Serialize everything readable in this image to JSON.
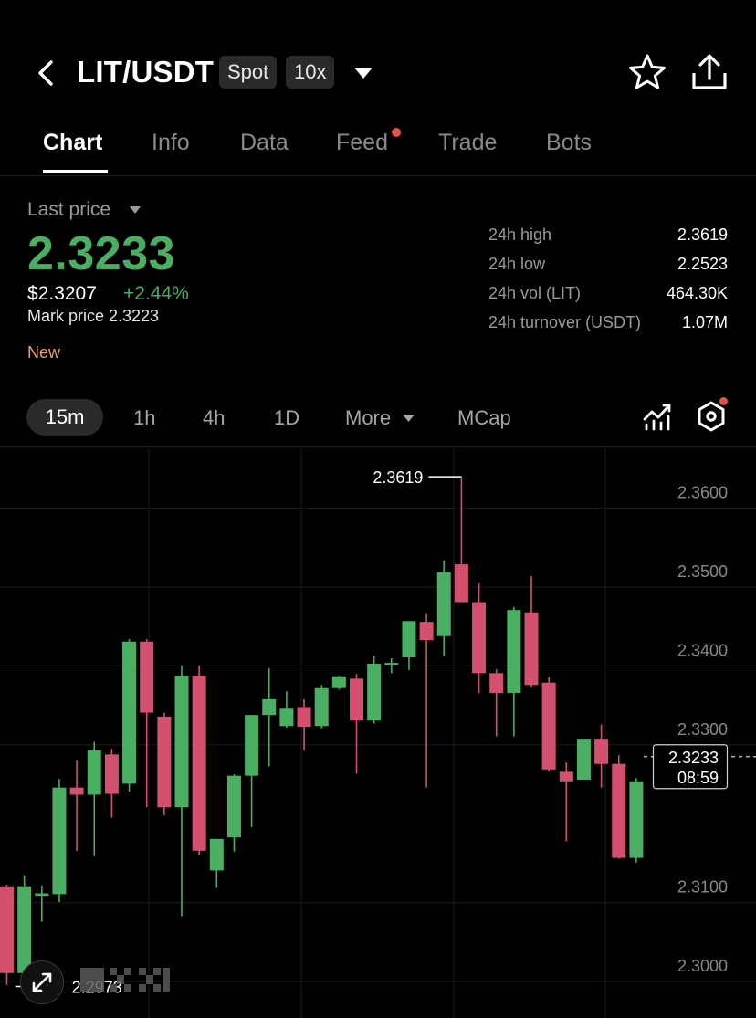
{
  "header": {
    "pair": "LIT/USDT",
    "market_type": "Spot",
    "leverage": "10x",
    "icons": [
      "back-arrow-icon",
      "chevron-down-icon",
      "star-icon",
      "share-icon"
    ]
  },
  "tabs": [
    {
      "label": "Chart",
      "active": true
    },
    {
      "label": "Info",
      "active": false
    },
    {
      "label": "Data",
      "active": false
    },
    {
      "label": "Feed",
      "active": false,
      "notification_dot": true
    },
    {
      "label": "Trade",
      "active": false
    },
    {
      "label": "Bots",
      "active": false
    }
  ],
  "price": {
    "label": "Last price",
    "last": "2.3233",
    "usd": "$2.3207",
    "change": "+2.44%",
    "mark": "Mark price 2.3223",
    "tag": "New"
  },
  "stats": [
    {
      "label": "24h high",
      "value": "2.3619"
    },
    {
      "label": "24h low",
      "value": "2.2523"
    },
    {
      "label": "24h vol (LIT)",
      "value": "464.30K"
    },
    {
      "label": "24h turnover (USDT)",
      "value": "1.07M"
    }
  ],
  "intervals": {
    "selected": "15m",
    "options": [
      "1h",
      "4h",
      "1D"
    ],
    "more": "More",
    "mcap": "MCap"
  },
  "colors": {
    "up": "#4aae63",
    "down": "#d4506f",
    "background": "#000000",
    "accent_dot": "#e2534e"
  },
  "chart_data": {
    "type": "candlestick",
    "interval": "15m",
    "ylim": [
      2.2962,
      2.3633
    ],
    "yticks": [
      "2.3600",
      "2.3500",
      "2.3400",
      "2.3300",
      "2.3100",
      "2.3000"
    ],
    "ytick_values": [
      2.36,
      2.35,
      2.34,
      2.33,
      2.31,
      2.3
    ],
    "high_label": "2.3619",
    "low_label": "2.2973",
    "current_price_label": "2.3233",
    "countdown": "08:59",
    "candles": [
      {
        "o": 2.31,
        "h": 2.3102,
        "l": 2.2975,
        "c": 2.299
      },
      {
        "o": 2.299,
        "h": 2.3114,
        "l": 2.2973,
        "c": 2.31
      },
      {
        "o": 2.3088,
        "h": 2.3101,
        "l": 2.3055,
        "c": 2.3091
      },
      {
        "o": 2.309,
        "h": 2.3236,
        "l": 2.308,
        "c": 2.3225
      },
      {
        "o": 2.3225,
        "h": 2.326,
        "l": 2.3145,
        "c": 2.3216
      },
      {
        "o": 2.3216,
        "h": 2.3283,
        "l": 2.3138,
        "c": 2.3272
      },
      {
        "o": 2.3267,
        "h": 2.3274,
        "l": 2.3187,
        "c": 2.3217
      },
      {
        "o": 2.323,
        "h": 2.3413,
        "l": 2.322,
        "c": 2.341
      },
      {
        "o": 2.341,
        "h": 2.3413,
        "l": 2.32,
        "c": 2.332
      },
      {
        "o": 2.3315,
        "h": 2.332,
        "l": 2.319,
        "c": 2.32
      },
      {
        "o": 2.32,
        "h": 2.338,
        "l": 2.3062,
        "c": 2.3367
      },
      {
        "o": 2.3367,
        "h": 2.338,
        "l": 2.314,
        "c": 2.3145
      },
      {
        "o": 2.312,
        "h": 2.316,
        "l": 2.3098,
        "c": 2.316
      },
      {
        "o": 2.3162,
        "h": 2.3242,
        "l": 2.3144,
        "c": 2.324
      },
      {
        "o": 2.324,
        "h": 2.3317,
        "l": 2.3175,
        "c": 2.3317
      },
      {
        "o": 2.3317,
        "h": 2.3376,
        "l": 2.3252,
        "c": 2.3337
      },
      {
        "o": 2.3303,
        "h": 2.3347,
        "l": 2.3301,
        "c": 2.3325
      },
      {
        "o": 2.3327,
        "h": 2.3337,
        "l": 2.3272,
        "c": 2.3302
      },
      {
        "o": 2.3303,
        "h": 2.3355,
        "l": 2.33,
        "c": 2.3351
      },
      {
        "o": 2.3351,
        "h": 2.3367,
        "l": 2.3349,
        "c": 2.3366
      },
      {
        "o": 2.3363,
        "h": 2.3369,
        "l": 2.3243,
        "c": 2.331
      },
      {
        "o": 2.331,
        "h": 2.3392,
        "l": 2.3306,
        "c": 2.3382
      },
      {
        "o": 2.3382,
        "h": 2.3389,
        "l": 2.337,
        "c": 2.3383
      },
      {
        "o": 2.339,
        "h": 2.3434,
        "l": 2.3374,
        "c": 2.3436
      },
      {
        "o": 2.3435,
        "h": 2.3446,
        "l": 2.3225,
        "c": 2.3412
      },
      {
        "o": 2.3417,
        "h": 2.3513,
        "l": 2.3392,
        "c": 2.3498
      },
      {
        "o": 2.3508,
        "h": 2.3619,
        "l": 2.347,
        "c": 2.346
      },
      {
        "o": 2.346,
        "h": 2.3484,
        "l": 2.3345,
        "c": 2.337
      },
      {
        "o": 2.337,
        "h": 2.3375,
        "l": 2.329,
        "c": 2.3345
      },
      {
        "o": 2.3345,
        "h": 2.3454,
        "l": 2.329,
        "c": 2.345
      },
      {
        "o": 2.3447,
        "h": 2.3493,
        "l": 2.3352,
        "c": 2.3355
      },
      {
        "o": 2.3358,
        "h": 2.3365,
        "l": 2.3245,
        "c": 2.3248
      },
      {
        "o": 2.3245,
        "h": 2.3257,
        "l": 2.3157,
        "c": 2.3233
      },
      {
        "o": 2.3235,
        "h": 2.3287,
        "l": 2.3235,
        "c": 2.3287
      },
      {
        "o": 2.3287,
        "h": 2.3305,
        "l": 2.3225,
        "c": 2.3255
      },
      {
        "o": 2.3255,
        "h": 2.3266,
        "l": 2.3135,
        "c": 2.3136
      },
      {
        "o": 2.3136,
        "h": 2.3237,
        "l": 2.313,
        "c": 2.3233
      }
    ]
  }
}
